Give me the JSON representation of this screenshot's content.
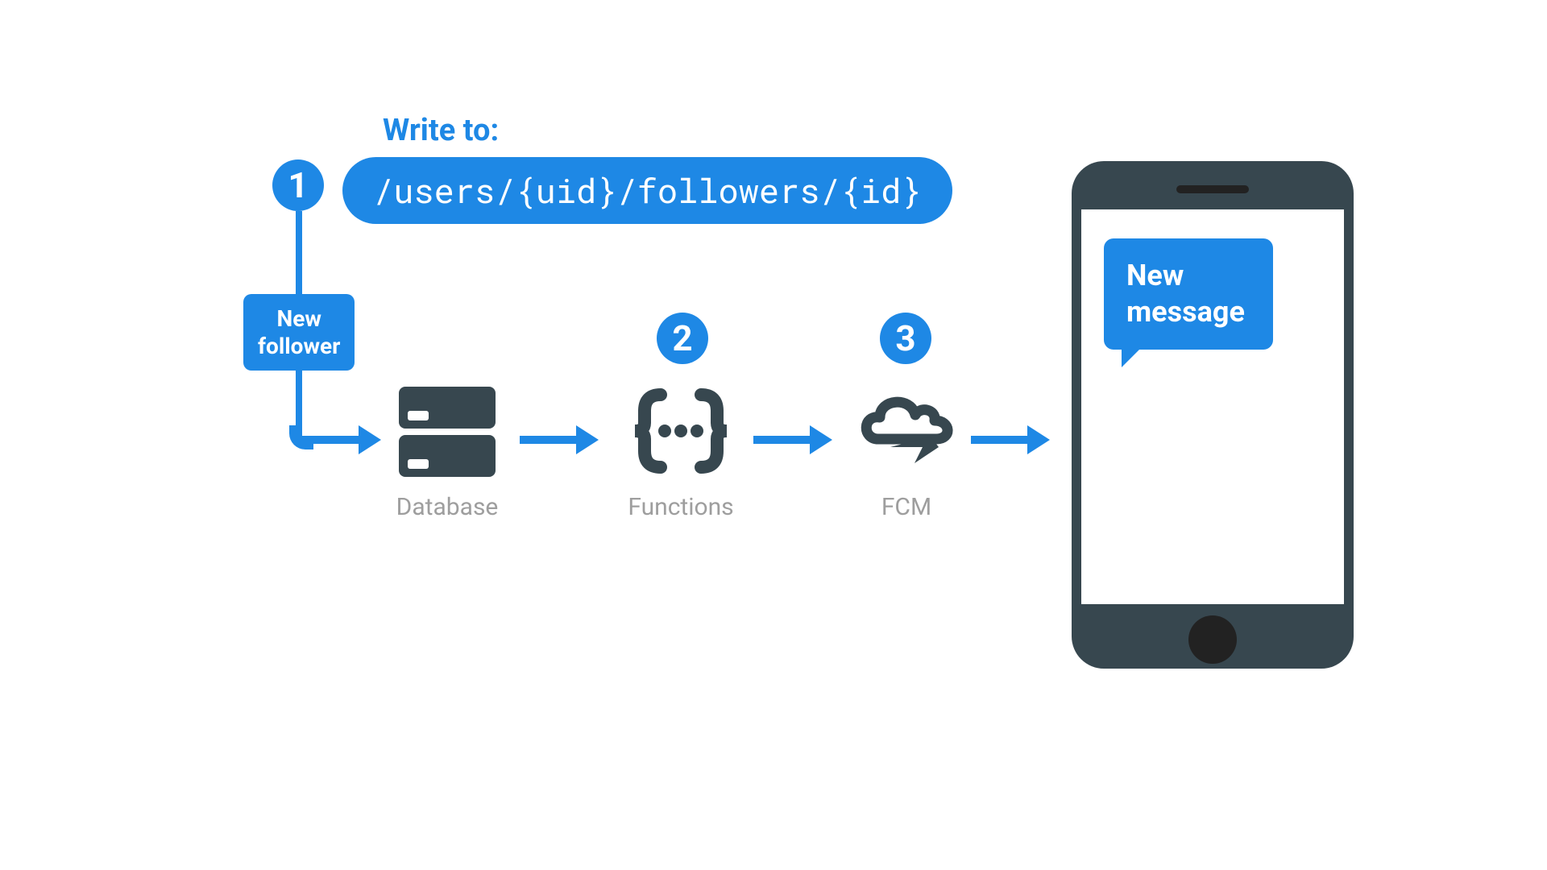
{
  "header": {
    "write_label": "Write to:",
    "path": "/users/{uid}/followers/{id}"
  },
  "steps": {
    "s1": "1",
    "s2": "2",
    "s3": "3"
  },
  "trigger": {
    "line1": "New",
    "line2": "follower"
  },
  "services": {
    "database": "Database",
    "functions": "Functions",
    "fcm": "FCM"
  },
  "phone": {
    "msg_line1": "New",
    "msg_line2": "message"
  },
  "colors": {
    "accent": "#1e88e5",
    "dark": "#37474f",
    "muted": "#9e9e9e"
  }
}
